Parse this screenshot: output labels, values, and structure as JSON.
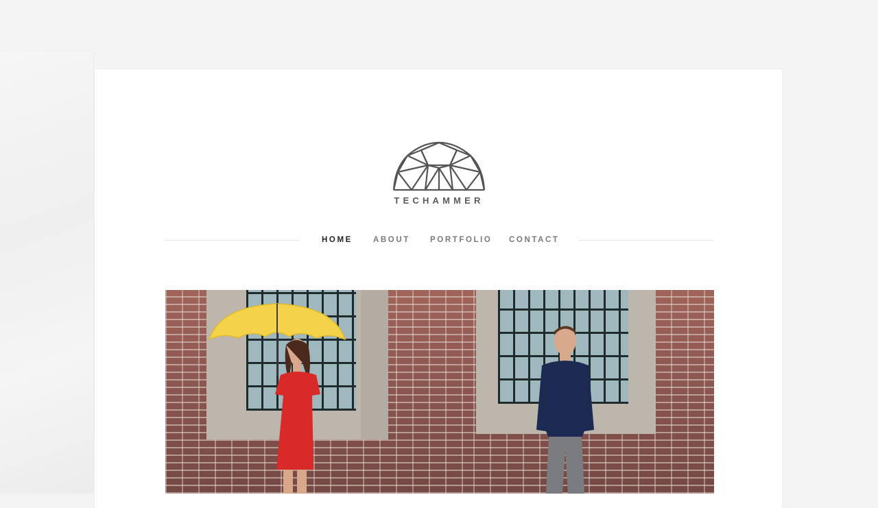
{
  "brand": {
    "name": "TECHAMMER",
    "logo_icon": "geodesic-dome-icon"
  },
  "nav": {
    "items": [
      {
        "label": "HOME",
        "active": true
      },
      {
        "label": "ABOUT",
        "active": false
      },
      {
        "label": "PORTFOLIO",
        "active": false
      },
      {
        "label": "CONTACT",
        "active": false
      }
    ]
  },
  "colors": {
    "page_background": "#f4f4f4",
    "card_background": "#ffffff",
    "nav_active": "#222222",
    "nav_inactive": "#7a7a7a",
    "logo": "#5a5a5a"
  },
  "photos": [
    {
      "subject": "woman-with-yellow-umbrella-photo"
    },
    {
      "subject": "man-in-navy-sweater-photo"
    }
  ]
}
